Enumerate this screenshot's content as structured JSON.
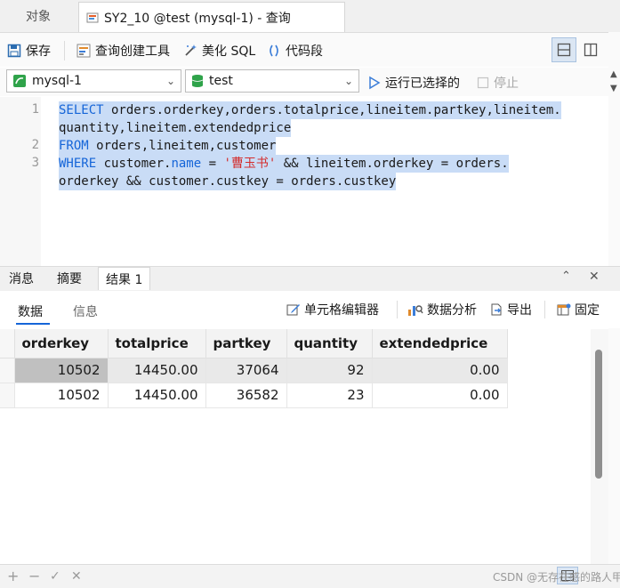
{
  "tabs": {
    "objects_label": "对象",
    "query_label": "SY2_10 @test (mysql-1) - 查询"
  },
  "toolbar": {
    "save_label": "保存",
    "query_builder_label": "查询创建工具",
    "beautify_label": "美化 SQL",
    "snippet_label": "代码段"
  },
  "selectors": {
    "connection": "mysql-1",
    "database": "test",
    "run_selected_label": "运行已选择的",
    "stop_label": "停止"
  },
  "editor": {
    "line_numbers": [
      "1",
      "2",
      "3"
    ],
    "lines": [
      {
        "kw": "SELECT",
        "rest": " orders.orderkey,orders.totalprice,lineitem.partkey,lineitem."
      },
      {
        "kw": "",
        "rest": "quantity,lineitem.extendedprice"
      },
      {
        "kw": "FROM",
        "rest": " orders,lineitem,customer"
      },
      {
        "kw": "WHERE",
        "pre": " customer.",
        "fn": "name",
        "eq": " = ",
        "str": "'曹玉书'",
        "rest": " && lineitem.orderkey = orders."
      },
      {
        "kw": "",
        "rest": "orderkey && customer.custkey = orders.custkey"
      }
    ]
  },
  "results": {
    "tabs": [
      "消息",
      "摘要",
      "结果 1"
    ],
    "subtabs": [
      "数据",
      "信息"
    ],
    "tools": {
      "cell_editor": "单元格编辑器",
      "data_analysis": "数据分析",
      "export": "导出",
      "pin": "固定"
    },
    "columns": [
      "orderkey",
      "totalprice",
      "partkey",
      "quantity",
      "extendedprice"
    ],
    "rows": [
      [
        "10502",
        "14450.00",
        "37064",
        "92",
        "0.00"
      ],
      [
        "10502",
        "14450.00",
        "36582",
        "23",
        "0.00"
      ]
    ]
  },
  "bottom": {
    "add": "+",
    "remove": "−",
    "apply": "✓",
    "discard": "✕",
    "watermark": "CSDN @无存在感的路人甲"
  },
  "colors": {
    "accent": "#1565d8",
    "selection": "#c9dcf6",
    "string": "#d42d2d"
  }
}
